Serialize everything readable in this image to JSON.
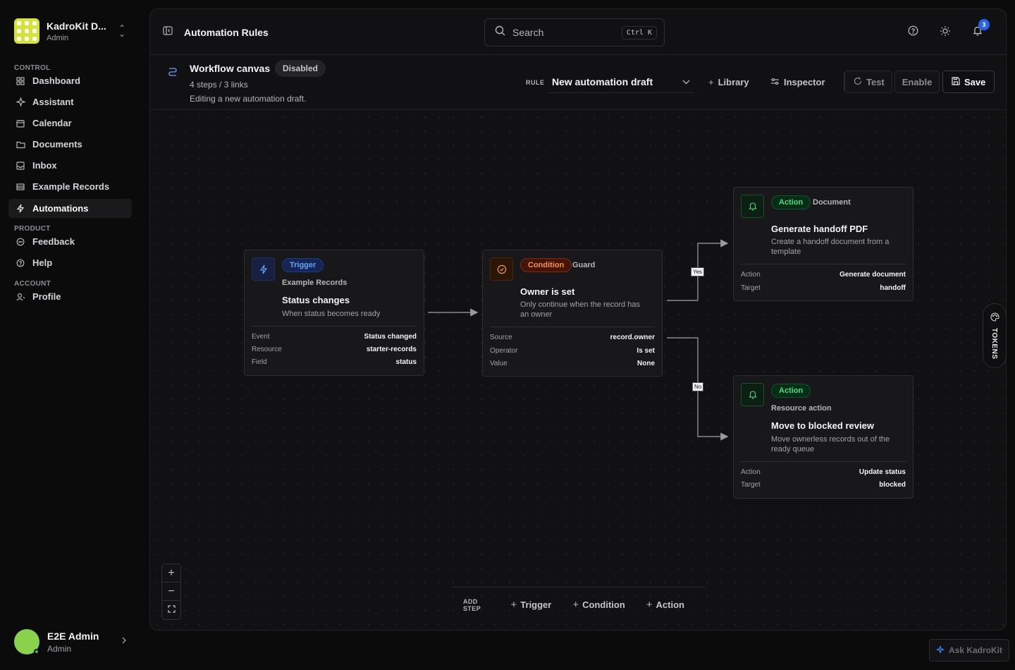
{
  "workspace": {
    "name": "KadroKit D...",
    "role": "Admin"
  },
  "sidebar": {
    "sections": {
      "control": "CONTROL",
      "product": "PRODUCT",
      "account": "ACCOUNT"
    },
    "items": [
      {
        "label": "Dashboard",
        "icon": "grid-icon"
      },
      {
        "label": "Assistant",
        "icon": "sparkle-icon"
      },
      {
        "label": "Calendar",
        "icon": "calendar-icon"
      },
      {
        "label": "Documents",
        "icon": "folder-icon"
      },
      {
        "label": "Inbox",
        "icon": "inbox-icon"
      },
      {
        "label": "Example Records",
        "icon": "table-icon"
      },
      {
        "label": "Automations",
        "icon": "bolt-icon",
        "active": true
      },
      {
        "label": "Feedback",
        "icon": "message-icon"
      },
      {
        "label": "Help",
        "icon": "help-icon"
      },
      {
        "label": "Profile",
        "icon": "user-icon"
      }
    ]
  },
  "user": {
    "name": "E2E Admin",
    "role": "Admin"
  },
  "header": {
    "title": "Automation Rules",
    "search_label": "Search",
    "search_shortcut": "Ctrl K",
    "notification_count": "3"
  },
  "workflow": {
    "title": "Workflow canvas",
    "status": "Disabled",
    "meta": "4 steps / 3 links",
    "description": "Editing a new automation draft.",
    "rule_label": "RULE",
    "rule_value": "New automation draft"
  },
  "toolbar": {
    "library": "Library",
    "inspector": "Inspector",
    "test": "Test",
    "enable": "Enable",
    "save": "Save"
  },
  "nodes": {
    "trigger": {
      "tag": "Trigger",
      "subtitle": "Example Records",
      "title": "Status changes",
      "description": "When status becomes ready",
      "fields": [
        {
          "k": "Event",
          "v": "Status changed"
        },
        {
          "k": "Resource",
          "v": "starter-records"
        },
        {
          "k": "Field",
          "v": "status"
        }
      ]
    },
    "condition": {
      "tag": "Condition",
      "subtitle": "Guard",
      "title": "Owner is set",
      "description": "Only continue when the record has an owner",
      "fields": [
        {
          "k": "Source",
          "v": "record.owner"
        },
        {
          "k": "Operator",
          "v": "Is set"
        },
        {
          "k": "Value",
          "v": "None"
        }
      ]
    },
    "action_doc": {
      "tag": "Action",
      "subtitle": "Document",
      "title": "Generate handoff PDF",
      "description": "Create a handoff document from a template",
      "fields": [
        {
          "k": "Action",
          "v": "Generate document"
        },
        {
          "k": "Target",
          "v": "handoff"
        }
      ]
    },
    "action_res": {
      "tag": "Action",
      "subtitle": "Resource action",
      "title": "Move to blocked review",
      "description": "Move ownerless records out of the ready queue",
      "fields": [
        {
          "k": "Action",
          "v": "Update status"
        },
        {
          "k": "Target",
          "v": "blocked"
        }
      ]
    }
  },
  "edges": {
    "yes": "Yes",
    "no": "No"
  },
  "add_step": {
    "label": "ADD STEP",
    "trigger": "Trigger",
    "condition": "Condition",
    "action": "Action"
  },
  "tokens_label": "TOKENS",
  "ask_label": "Ask KadroKit",
  "colors": {
    "accent_blue": "#2563eb",
    "trigger": "#60a5fa",
    "condition": "#fb923c",
    "action": "#4ade80"
  }
}
